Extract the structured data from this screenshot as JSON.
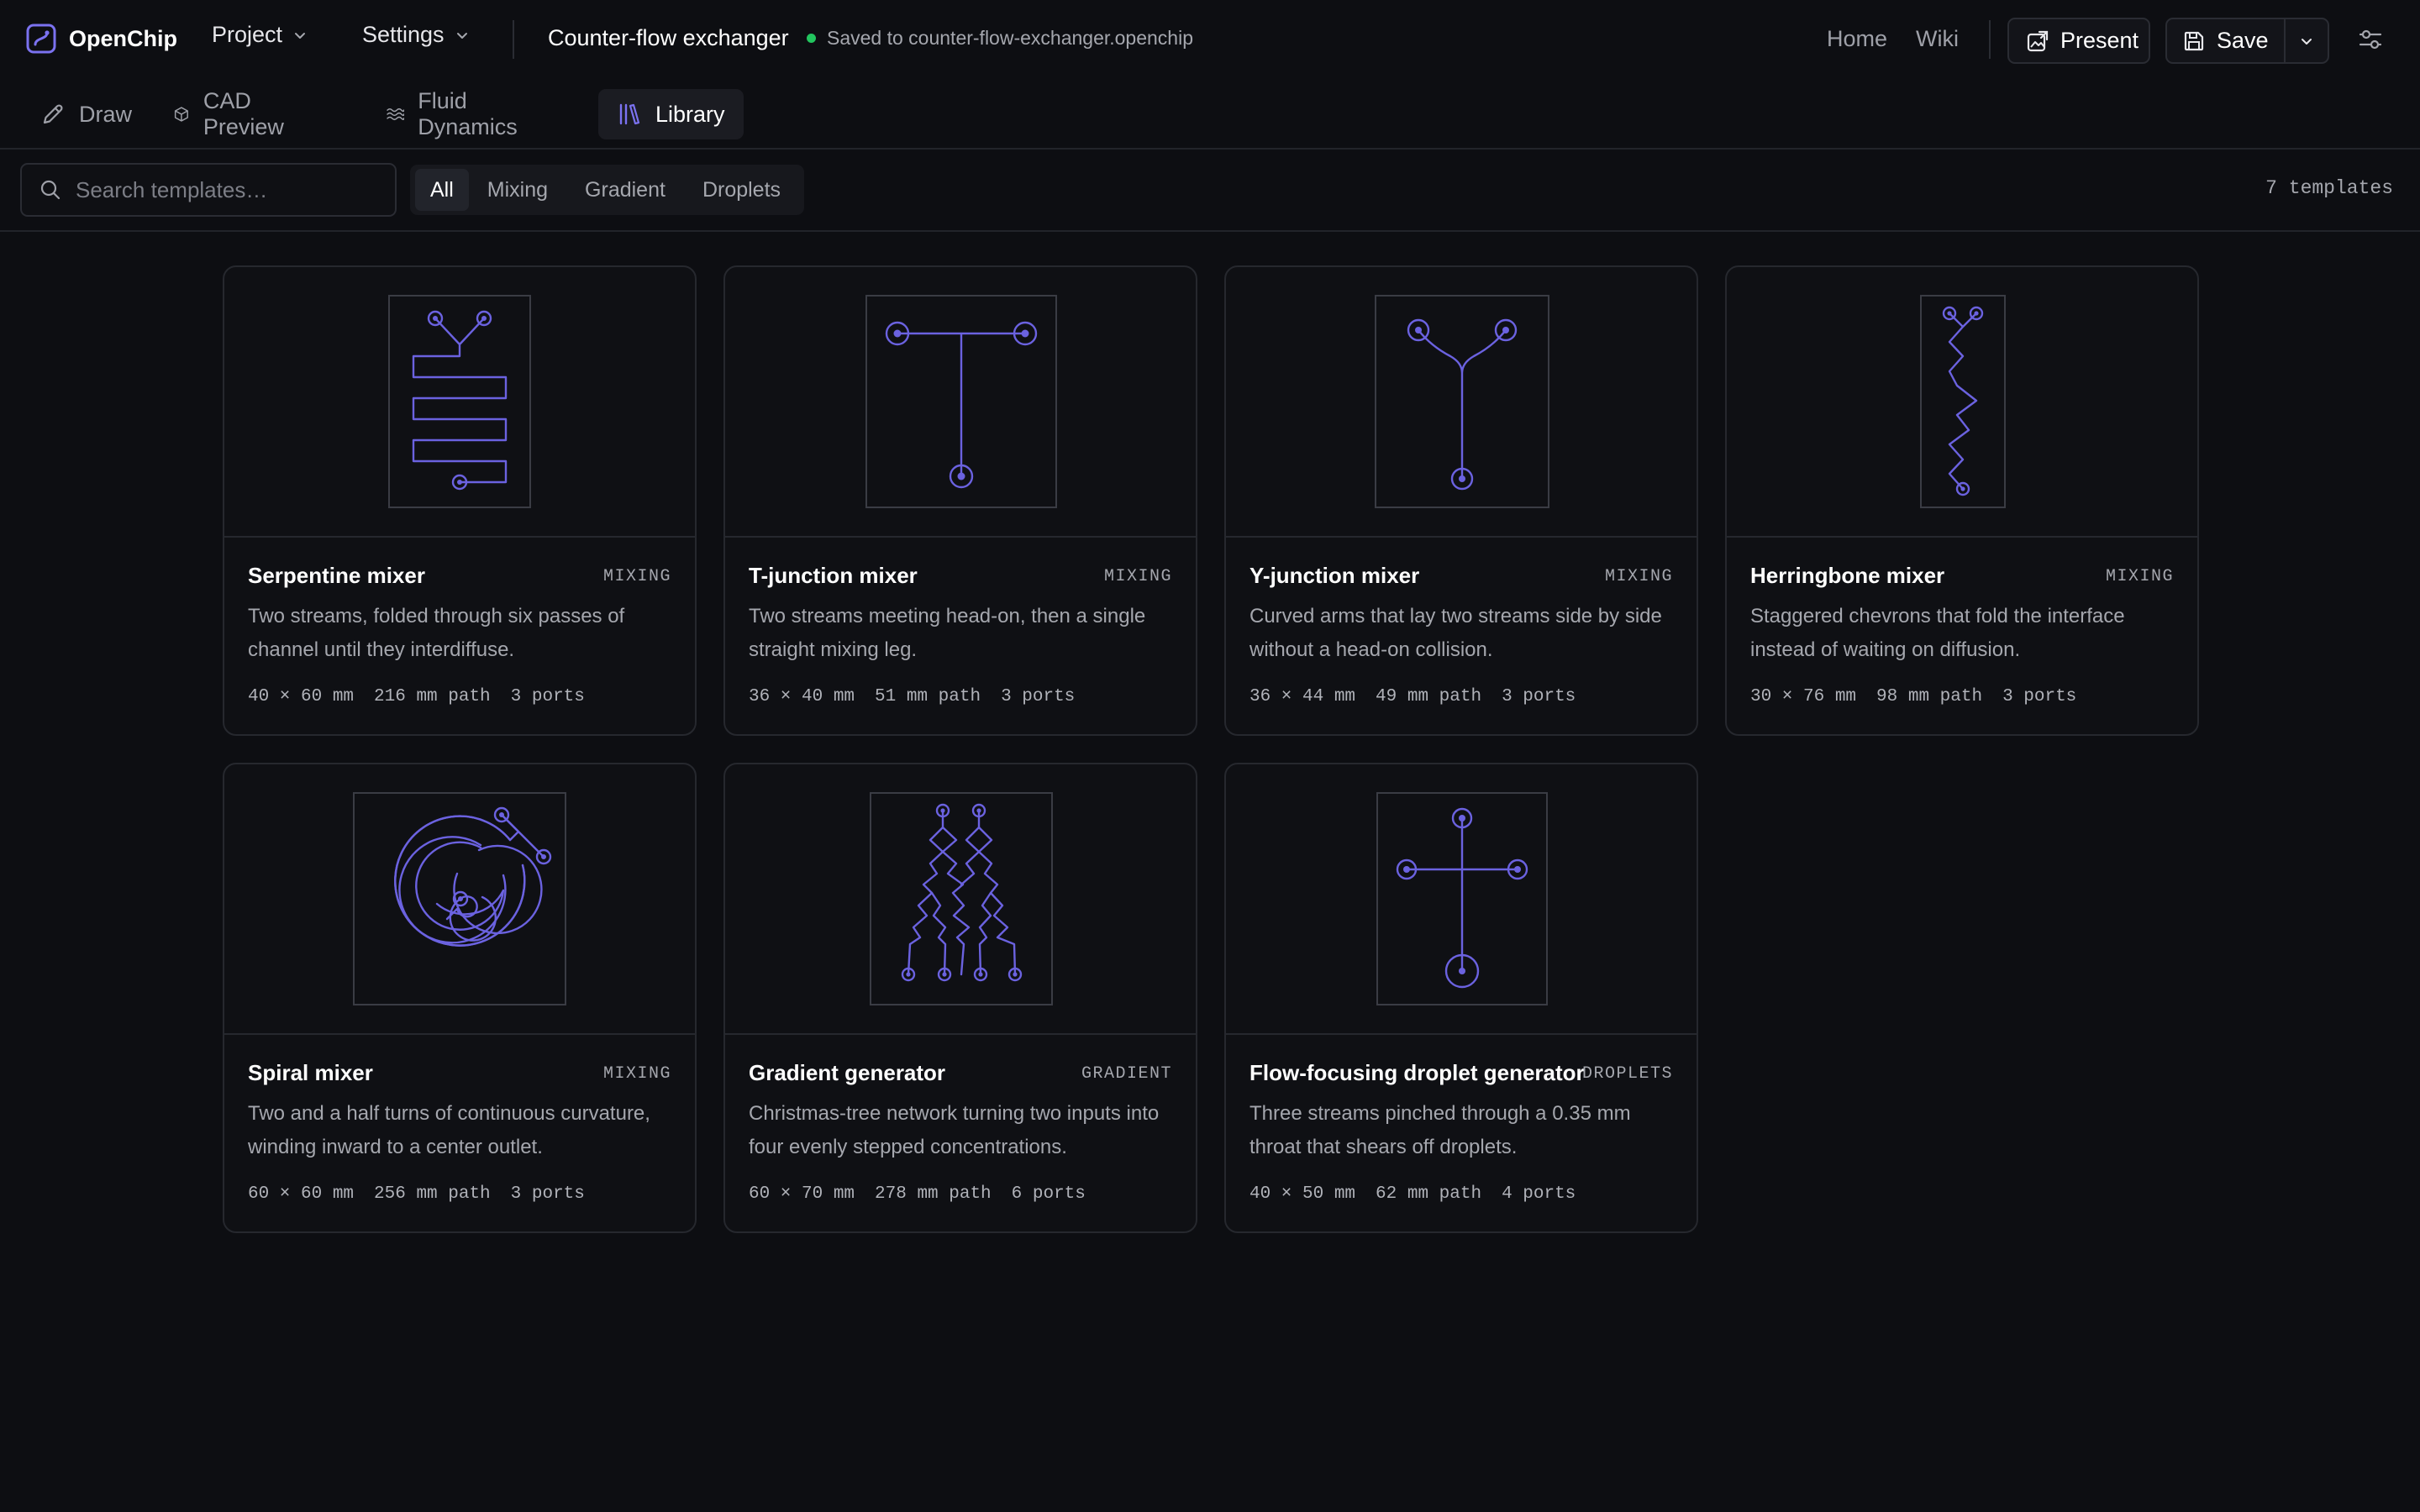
{
  "brand": {
    "name": "OpenChip",
    "logo_icon": "openchip-logo-icon"
  },
  "menus": {
    "project": "Project",
    "settings": "Settings"
  },
  "document": {
    "title": "Counter-flow exchanger",
    "status": "Saved to counter-flow-exchanger.openchip",
    "status_color": "#22c55e"
  },
  "nav": {
    "home": "Home",
    "wiki": "Wiki"
  },
  "actions": {
    "present": "Present",
    "save": "Save"
  },
  "tabs": [
    {
      "label": "Draw",
      "icon": "pencil-icon"
    },
    {
      "label": "CAD Preview",
      "icon": "cube-icon"
    },
    {
      "label": "Fluid Dynamics",
      "icon": "waves-icon"
    },
    {
      "label": "Library",
      "icon": "library-icon",
      "active": true
    }
  ],
  "search": {
    "placeholder": "Search templates…",
    "value": ""
  },
  "filters": [
    {
      "label": "All",
      "active": true
    },
    {
      "label": "Mixing"
    },
    {
      "label": "Gradient"
    },
    {
      "label": "Droplets"
    }
  ],
  "template_count": "7 templates",
  "accent_color": "#6b62e0",
  "templates": [
    {
      "title": "Serpentine mixer",
      "category": "MIXING",
      "description": "Two streams, folded through six passes of channel until they interdiffuse.",
      "size": "40 × 60 mm",
      "path": "216 mm path",
      "ports": "3 ports"
    },
    {
      "title": "T-junction mixer",
      "category": "MIXING",
      "description": "Two streams meeting head-on, then a single straight mixing leg.",
      "size": "36 × 40 mm",
      "path": "51 mm path",
      "ports": "3 ports"
    },
    {
      "title": "Y-junction mixer",
      "category": "MIXING",
      "description": "Curved arms that lay two streams side by side without a head-on collision.",
      "size": "36 × 44 mm",
      "path": "49 mm path",
      "ports": "3 ports"
    },
    {
      "title": "Herringbone mixer",
      "category": "MIXING",
      "description": "Staggered chevrons that fold the interface instead of waiting on diffusion.",
      "size": "30 × 76 mm",
      "path": "98 mm path",
      "ports": "3 ports"
    },
    {
      "title": "Spiral mixer",
      "category": "MIXING",
      "description": "Two and a half turns of continuous curvature, winding inward to a center outlet.",
      "size": "60 × 60 mm",
      "path": "256 mm path",
      "ports": "3 ports"
    },
    {
      "title": "Gradient generator",
      "category": "GRADIENT",
      "description": "Christmas-tree network turning two inputs into four evenly stepped concentrations.",
      "size": "60 × 70 mm",
      "path": "278 mm path",
      "ports": "6 ports"
    },
    {
      "title": "Flow-focusing droplet generator",
      "category": "DROPLETS",
      "description": "Three streams pinched through a 0.35 mm throat that shears off droplets.",
      "size": "40 × 50 mm",
      "path": "62 mm path",
      "ports": "4 ports"
    }
  ]
}
